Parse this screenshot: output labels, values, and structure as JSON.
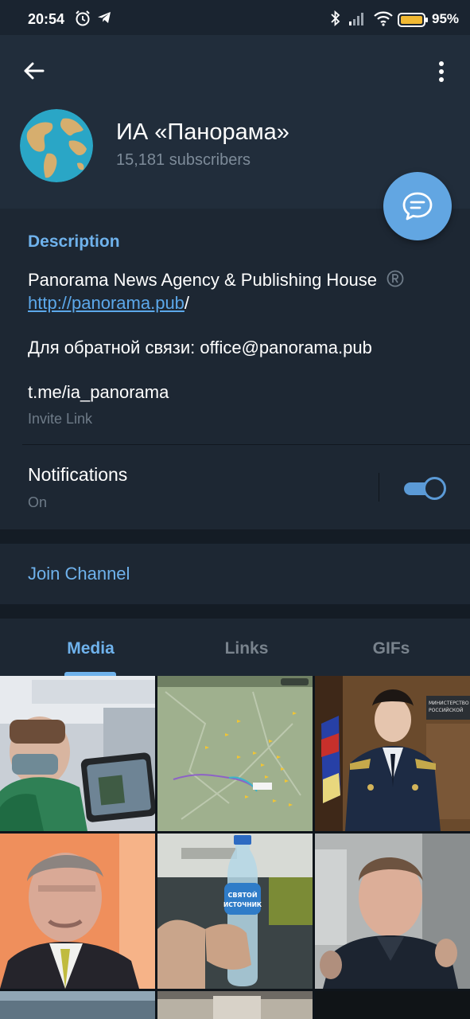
{
  "status_bar": {
    "time": "20:54",
    "battery_percent": "95%",
    "icons": [
      "alarm-icon",
      "telegram-icon",
      "bluetooth-icon",
      "signal-icon",
      "wifi-icon",
      "battery-icon"
    ]
  },
  "header": {
    "title": "ИА «Панорама»",
    "subtitle": "15,181 subscribers",
    "back_icon": "back-arrow-icon",
    "more_icon": "more-vertical-icon",
    "fab_icon": "chat-bubble-icon"
  },
  "info": {
    "section_title": "Description",
    "description_line1": "Panorama News Agency & Publishing House",
    "description_link": "http://panorama.pub",
    "description_link_suffix": "/",
    "feedback_line": "Для обратной связи: office@panorama.pub",
    "invite_link": "t.me/ia_panorama",
    "invite_link_label": "Invite Link",
    "notifications_label": "Notifications",
    "notifications_status": "On",
    "notifications_on": true
  },
  "join": {
    "label": "Join Channel"
  },
  "tabs": [
    {
      "label": "Media",
      "active": true
    },
    {
      "label": "Links",
      "active": false
    },
    {
      "label": "GIFs",
      "active": false
    }
  ],
  "colors": {
    "accent": "#6fb2ec",
    "header_bg": "#212d3b",
    "section_bg": "#1d2733",
    "fab": "#62a6e2"
  },
  "media_thumbnails": [
    "photo-man-on-plane",
    "photo-flight-tracker-map",
    "photo-police-spokeswoman",
    "photo-kremlin-spokesman",
    "photo-water-bottle-svyatoy-istochnik",
    "photo-man-in-crowd",
    "photo-partial-row-1",
    "photo-partial-row-2",
    "photo-partial-row-3"
  ],
  "thumbnail_text": {
    "bottle_label_line1": "СВЯТОЙ",
    "bottle_label_line2": "ИСТОЧНИК",
    "ministry_sign_line1": "МИНИСТЕРСТВО",
    "ministry_sign_line2": "РОССИЙСКОЙ"
  }
}
